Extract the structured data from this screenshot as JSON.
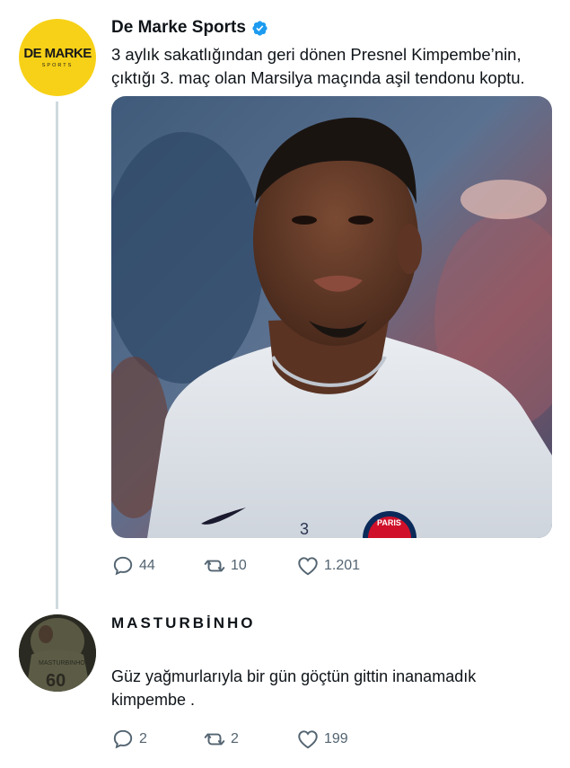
{
  "tweet": {
    "author": {
      "display_name": "De Marke Sports",
      "verified": true,
      "avatar": {
        "logo_main": "DE MARKE",
        "logo_sub": "SPORTS",
        "color": "#f7d117"
      }
    },
    "text": "3 aylık sakatlığından geri dönen Presnel Kimpembe’nin, çıktığı 3. maç olan Marsilya maçında aşil tendonu koptu.",
    "media": {
      "jersey_number": "3",
      "crest_text": "PARIS"
    },
    "stats": {
      "replies": "44",
      "retweets": "10",
      "likes": "1.201"
    }
  },
  "reply": {
    "author": {
      "display_name": "MASTURBİNHO",
      "avatar_jersey": "60",
      "avatar_name": "MASTURBINHO"
    },
    "text": "Güz yağmurlarıyla bir gün göçtün gittin inanamadık kimpembe .",
    "stats": {
      "replies": "2",
      "retweets": "2",
      "likes": "199"
    }
  },
  "colors": {
    "verified": "#1d9bf0",
    "icon_gray": "#536471",
    "thread_line": "#cfd9de"
  }
}
